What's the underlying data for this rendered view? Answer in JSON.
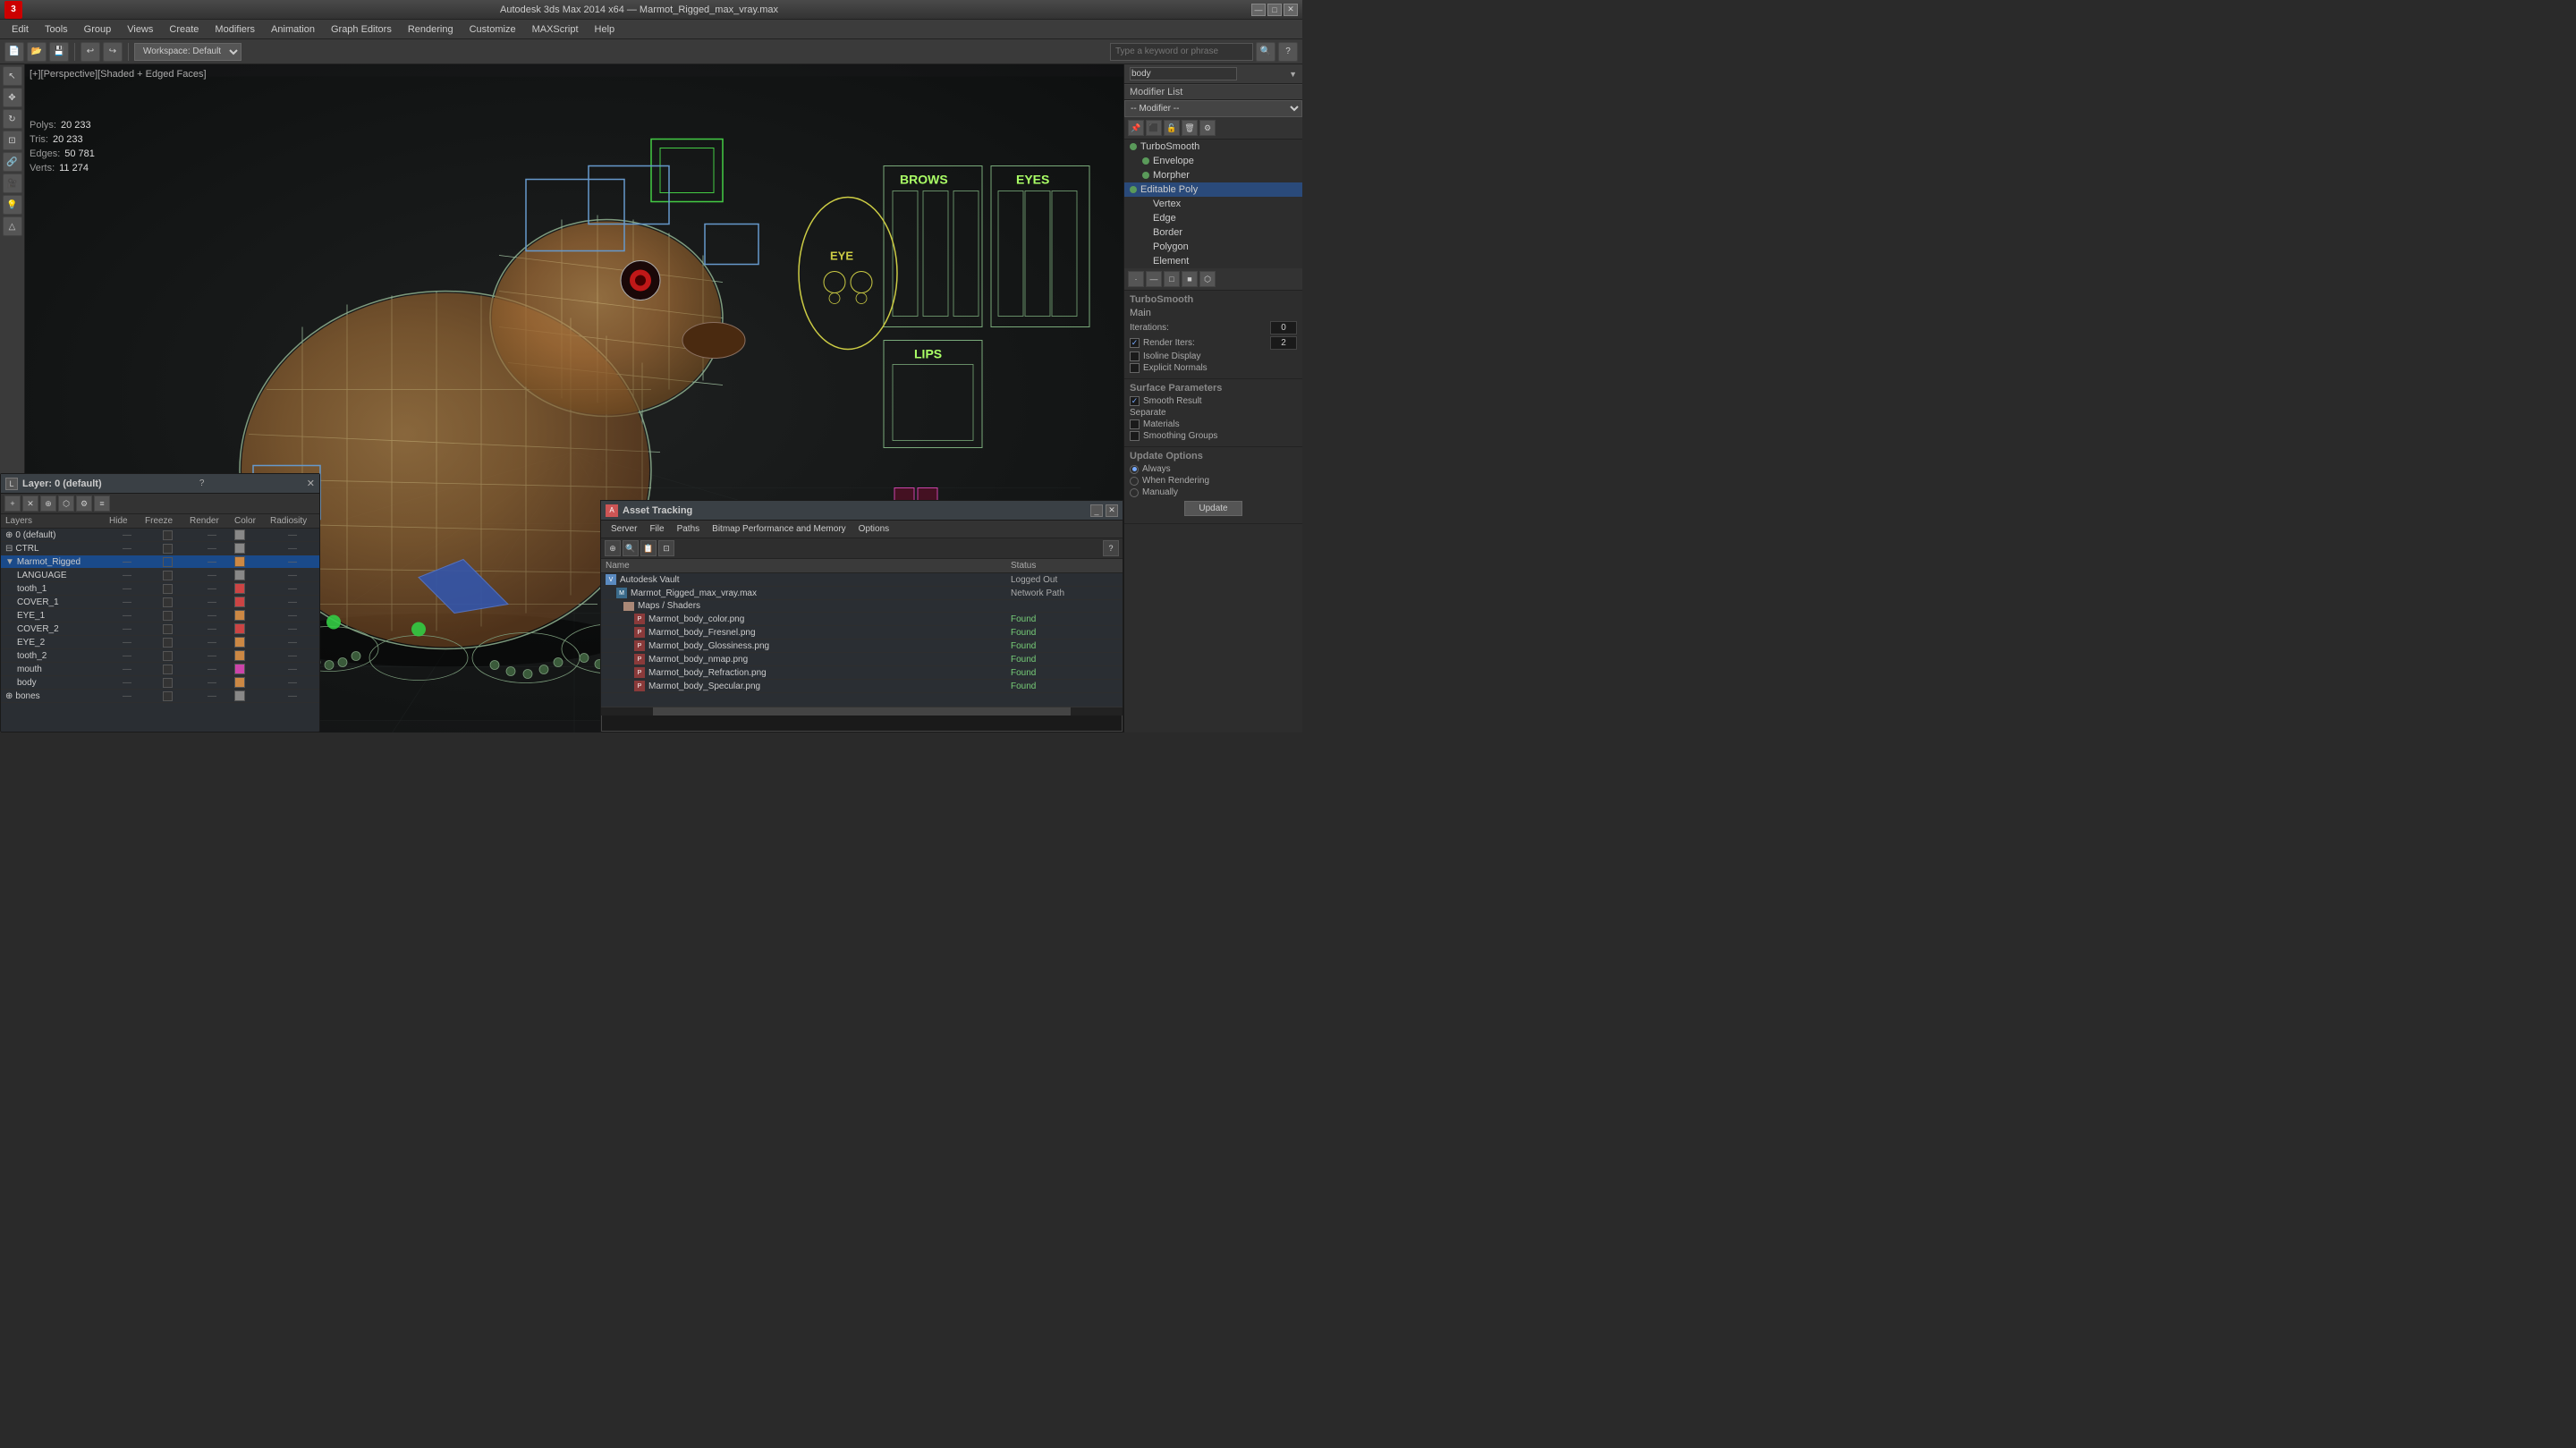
{
  "titlebar": {
    "app_icon": "3",
    "title": "Autodesk 3ds Max 2014 x64 — Marmot_Rigged_max_vray.max",
    "btn_minimize": "—",
    "btn_maximize": "□",
    "btn_close": "✕"
  },
  "menubar": {
    "items": [
      "Edit",
      "Tools",
      "Group",
      "Views",
      "Create",
      "Modifiers",
      "Animation",
      "Graph Editors",
      "Rendering",
      "Customize",
      "MAXScript",
      "Help"
    ]
  },
  "toolbar": {
    "workspace_label": "Workspace: Default",
    "search_placeholder": "Type a keyword or phrase"
  },
  "viewport": {
    "label": "[+][Perspective][Shaded + Edged Faces]",
    "stats": {
      "polys_label": "Polys:",
      "polys_val": "20 233",
      "tris_label": "Tris:",
      "tris_val": "20 233",
      "edges_label": "Edges:",
      "edges_val": "50 781",
      "verts_label": "Verts:",
      "verts_val": "11 274"
    }
  },
  "right_panel": {
    "body_label": "body",
    "modifier_list_label": "Modifier List",
    "modifiers": [
      {
        "name": "TurboSmooth",
        "type": "turbosmooth"
      },
      {
        "name": "Envelope",
        "type": "envelope",
        "indent": 1
      },
      {
        "name": "Morpher",
        "type": "morpher",
        "indent": 1
      },
      {
        "name": "Editable Poly",
        "type": "editpoly",
        "indent": 0
      },
      {
        "name": "Vertex",
        "type": "sub",
        "indent": 1
      },
      {
        "name": "Edge",
        "type": "sub",
        "indent": 1
      },
      {
        "name": "Border",
        "type": "sub",
        "indent": 1
      },
      {
        "name": "Polygon",
        "type": "sub",
        "indent": 1
      },
      {
        "name": "Element",
        "type": "sub",
        "indent": 1
      }
    ],
    "turbosmooth": {
      "section_main": "Main",
      "iterations_label": "Iterations:",
      "iterations_val": "0",
      "render_iters_label": "Render Iters:",
      "render_iters_val": "2",
      "isoline_label": "Isoline Display",
      "explicit_label": "Explicit Normals",
      "surface_label": "Surface Parameters",
      "smooth_result_label": "Smooth Result",
      "separate_label": "Separate",
      "materials_label": "Materials",
      "smoothing_label": "Smoothing Groups",
      "update_label": "Update Options",
      "always_label": "Always",
      "when_rendering_label": "When Rendering",
      "manually_label": "Manually",
      "update_btn": "Update"
    },
    "edge_label": "Edge",
    "envelope_label": "Envelope"
  },
  "face_controls": {
    "brows_label": "BROWS",
    "eyes_label": "EYES",
    "eye_label": "EYE",
    "lips_label": "LIPS"
  },
  "layers_panel": {
    "title": "Layer: 0 (default)",
    "columns": [
      "Layers",
      "Hide",
      "Freeze",
      "Render",
      "Color",
      "Radiosity"
    ],
    "layers": [
      {
        "name": "0 (default)",
        "selected": false,
        "freeze_check": false,
        "color": "#888"
      },
      {
        "name": "CTRL",
        "selected": false,
        "freeze_check": false,
        "color": "#888"
      },
      {
        "name": "Marmot_Rigged",
        "selected": true,
        "freeze_check": true,
        "color": "#c84"
      },
      {
        "name": "LANGUAGE",
        "selected": false,
        "freeze_check": false,
        "color": "#888",
        "indent": true
      },
      {
        "name": "tooth_1",
        "selected": false,
        "freeze_check": false,
        "color": "#c44",
        "indent": true
      },
      {
        "name": "COVER_1",
        "selected": false,
        "freeze_check": false,
        "color": "#c44",
        "indent": true
      },
      {
        "name": "EYE_1",
        "selected": false,
        "freeze_check": false,
        "color": "#c84",
        "indent": true
      },
      {
        "name": "COVER_2",
        "selected": false,
        "freeze_check": false,
        "color": "#c44",
        "indent": true
      },
      {
        "name": "EYE_2",
        "selected": false,
        "freeze_check": false,
        "color": "#c84",
        "indent": true
      },
      {
        "name": "tooth_2",
        "selected": false,
        "freeze_check": false,
        "color": "#c84",
        "indent": true
      },
      {
        "name": "mouth",
        "selected": false,
        "freeze_check": false,
        "color": "#c4a",
        "indent": true
      },
      {
        "name": "body",
        "selected": false,
        "freeze_check": false,
        "color": "#c84",
        "indent": true
      },
      {
        "name": "bones",
        "selected": false,
        "freeze_check": false,
        "color": "#888"
      }
    ]
  },
  "asset_panel": {
    "title": "Asset Tracking",
    "menu_items": [
      "Server",
      "File",
      "Paths",
      "Bitmap Performance and Memory",
      "Options"
    ],
    "columns": [
      "Name",
      "Status"
    ],
    "assets": [
      {
        "name": "Autodesk Vault",
        "status": "Logged Out",
        "type": "vault",
        "indent": 0
      },
      {
        "name": "Marmot_Rigged_max_vray.max",
        "status": "Network Path",
        "type": "max",
        "indent": 0
      },
      {
        "name": "Maps / Shaders",
        "status": "",
        "type": "folder",
        "indent": 1
      },
      {
        "name": "Marmot_body_color.png",
        "status": "Found",
        "type": "png",
        "indent": 2
      },
      {
        "name": "Marmot_body_Fresnel.png",
        "status": "Found",
        "type": "png",
        "indent": 2
      },
      {
        "name": "Marmot_body_Glossiness.png",
        "status": "Found",
        "type": "png",
        "indent": 2
      },
      {
        "name": "Marmot_body_nmap.png",
        "status": "Found",
        "type": "png",
        "indent": 2
      },
      {
        "name": "Marmot_body_Refraction.png",
        "status": "Found",
        "type": "png",
        "indent": 2
      },
      {
        "name": "Marmot_body_Specular.png",
        "status": "Found",
        "type": "png",
        "indent": 2
      }
    ]
  }
}
